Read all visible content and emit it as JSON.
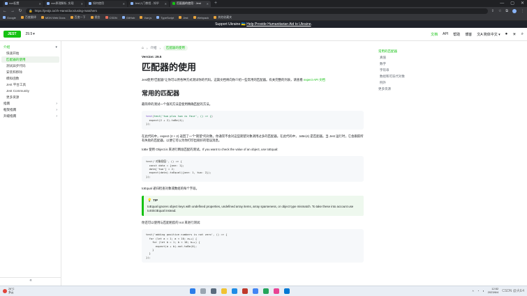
{
  "browser": {
    "tabs": [
      {
        "label": "vue配置"
      },
      {
        "label": "vue原理解析, 实现"
      },
      {
        "label": "如何使用"
      },
      {
        "label": "Jest入门教程 - 知乎"
      },
      {
        "label": "匹配器的使用 · Jest",
        "active": true
      }
    ],
    "new_tab": "+",
    "url": "https://jestjs.io/zh-Hans/docs/using-matchers",
    "bookmarks": [
      {
        "label": "Google",
        "color": "blue"
      },
      {
        "label": "百度翻译"
      },
      {
        "label": "MDN Web Docs"
      },
      {
        "label": "百度一下"
      },
      {
        "label": "掘金"
      },
      {
        "label": "CSDN",
        "color": "red"
      },
      {
        "label": "GitHub",
        "color": "blue"
      },
      {
        "label": "Vue.js"
      },
      {
        "label": "TypeScript",
        "color": "blue"
      },
      {
        "label": "Jest"
      },
      {
        "label": "Webpack"
      },
      {
        "label": "其他收藏夹"
      }
    ]
  },
  "banner": {
    "text_before": "Support Ukraine 🇺🇦",
    "link": "Help Provide Humanitarian Aid to Ukraine",
    "text_after": "."
  },
  "navbar": {
    "logo": "JEST",
    "version": "29.5",
    "links": [
      {
        "label": "文档",
        "active": true
      },
      {
        "label": "API"
      },
      {
        "label": "帮助"
      },
      {
        "label": "博客"
      },
      {
        "label": "简体中文 ▾"
      }
    ]
  },
  "sidebar": {
    "items": [
      {
        "label": "介绍",
        "kind": "cat",
        "chevron": "▾"
      },
      {
        "label": "快速开始",
        "kind": "sub"
      },
      {
        "label": "匹配器的使用",
        "kind": "sub",
        "active": true
      },
      {
        "label": "测试异步代码",
        "kind": "sub"
      },
      {
        "label": "安装和移除",
        "kind": "sub"
      },
      {
        "label": "模拟函数",
        "kind": "sub"
      },
      {
        "label": "Jest 平台工具",
        "kind": "sub"
      },
      {
        "label": "Jest Community",
        "kind": "sub"
      },
      {
        "label": "更多资源",
        "kind": "sub"
      },
      {
        "label": "指南",
        "kind": "cat2",
        "chevron": "›"
      },
      {
        "label": "框架指南",
        "kind": "cat2",
        "chevron": "›"
      },
      {
        "label": "升级指南",
        "kind": "cat2",
        "chevron": "›"
      }
    ],
    "collapse": "«"
  },
  "main": {
    "breadcrumb": {
      "home": "⌂",
      "sep": "›",
      "section": "介绍",
      "current": "匹配器的使用"
    },
    "version_badge": "Version: 29.5",
    "title": "匹配器的使用",
    "intro": "Jest使用\"匹配器\"让你可以用各种方式测试你的代码。这篇文档将向你介绍一些常用的匹配器。有关完整的列表，请查看",
    "intro_link": "expect API 文档",
    "h2": "常用的匹配器",
    "p1": "最简单的测试一个值的方法是使用精确匹配的方法。",
    "code1": [
      "test('two plus two is four', () => {",
      "  expect(2 + 2).toBe(4);",
      "});"
    ],
    "p2": "在此代码中，expect (2 + 2) 返回了一个\"期望\"的对象。你通常不会对这些期望对象调用过多的匹配器。在此代码中，.toBe(4) 是匹配器。当 Jest 运行时，它会跟踪所有失败的匹配器，以便它可以为你打印出很好的错误消息。",
    "p3": "toBe 使用 Object.is 来进行精准匹配的测试。If you want to check the value of an object, use toEqual:",
    "code2": [
      "test('对象赋值', () => {",
      "  const data = {one: 1};",
      "  data['two'] = 2;",
      "  expect(data).toEqual({one: 1, two: 2});",
      "});"
    ],
    "p4": "toEqual 递归检查对象或数组的每个字段。",
    "tip_title": "TIP",
    "tip_text": "toEqual ignores object keys with undefined properties, undefined array items, array sparseness, or object type mismatch. To take these into account use toStrictEqual instead.",
    "p5": "你还可以使用与匹配相反的 not 来进行测试:",
    "code3": [
      "test('adding positive numbers is not zero', () => {",
      "  for (let a = 1; a < 10; a++) {",
      "    for (let b = 1; b < 10; b++) {",
      "      expect(a + b).not.toBe(0);",
      "    }",
      "  }",
      "});"
    ]
  },
  "toc": {
    "items": [
      {
        "label": "常用的匹配器",
        "active": true
      },
      {
        "label": "真值"
      },
      {
        "label": "数字"
      },
      {
        "label": "字符串"
      },
      {
        "label": "数组和可迭代对象"
      },
      {
        "label": "例外"
      },
      {
        "label": "更多资源"
      }
    ]
  },
  "taskbar": {
    "weather_temp": "26°C",
    "weather_desc": "多云",
    "time": "12:52",
    "date": "2023/6/4",
    "watermark": "CSDN @大E4"
  }
}
